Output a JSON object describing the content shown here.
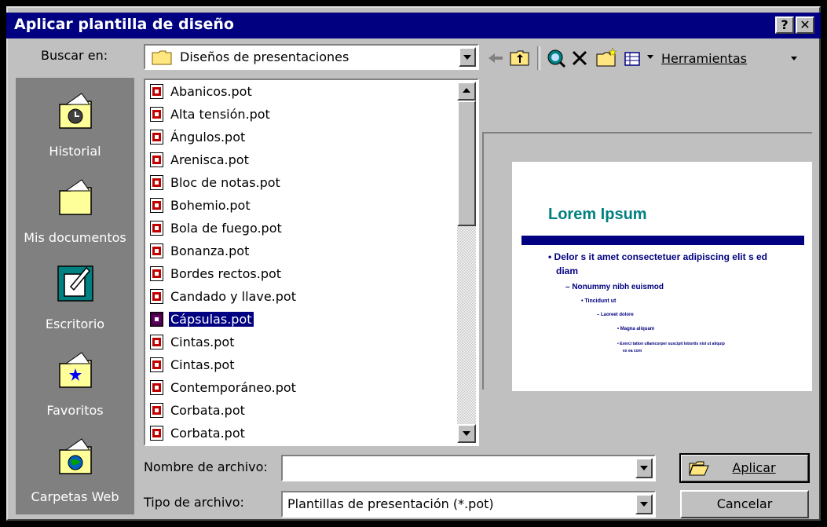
{
  "window": {
    "title": "Aplicar plantilla de diseño"
  },
  "titlebar": {
    "help_glyph": "?",
    "close_glyph": "✕"
  },
  "look_in": {
    "label": "Buscar en:",
    "folder": "Diseños de presentaciones"
  },
  "toolbar": {
    "tools_label": "Herramientas"
  },
  "places": [
    {
      "label": "Historial",
      "icon": "history-folder-icon"
    },
    {
      "label": "Mis documentos",
      "icon": "my-documents-folder-icon"
    },
    {
      "label": "Escritorio",
      "icon": "desktop-icon"
    },
    {
      "label": "Favoritos",
      "icon": "favorites-folder-icon"
    },
    {
      "label": "Carpetas Web",
      "icon": "web-folders-icon"
    }
  ],
  "files": [
    "Abanicos.pot",
    "Alta tensión.pot",
    "Ángulos.pot",
    "Arenisca.pot",
    "Bloc de notas.pot",
    "Bohemio.pot",
    "Bola de fuego.pot",
    "Bonanza.pot",
    "Bordes rectos.pot",
    "Candado y llave.pot",
    "Cápsulas.pot",
    "Cintas.pot",
    "Cintas.pot",
    "Contemporáneo.pot",
    "Corbata.pot",
    "Corbata.pot"
  ],
  "selected_file": "Cápsulas.pot",
  "preview": {
    "title": "Lorem Ipsum",
    "bullet1": "• Delor s it amet consectetuer adipiscing elit s ed",
    "bullet1b": "diam",
    "bullet2": "– Nonummy nibh euismod",
    "bullet3": "• Tincidunt ut",
    "bullet4": "– Laoreet dolore",
    "bullet5": "• Magna aliquam",
    "bullet6": "• Exerci tation ullamcorper suscipit lobortis nisl ut aliquip",
    "bullet6b": "ex ea com"
  },
  "filename": {
    "label": "Nombre de archivo:",
    "value": ""
  },
  "filetype": {
    "label": "Tipo de archivo:",
    "value": "Plantillas de presentación (*.pot)"
  },
  "buttons": {
    "apply": "Aplicar",
    "cancel": "Cancelar"
  },
  "colors": {
    "titlebar": "#000080",
    "face": "#c0c0c0",
    "places_bg": "#808080",
    "preview_title": "#008080"
  }
}
